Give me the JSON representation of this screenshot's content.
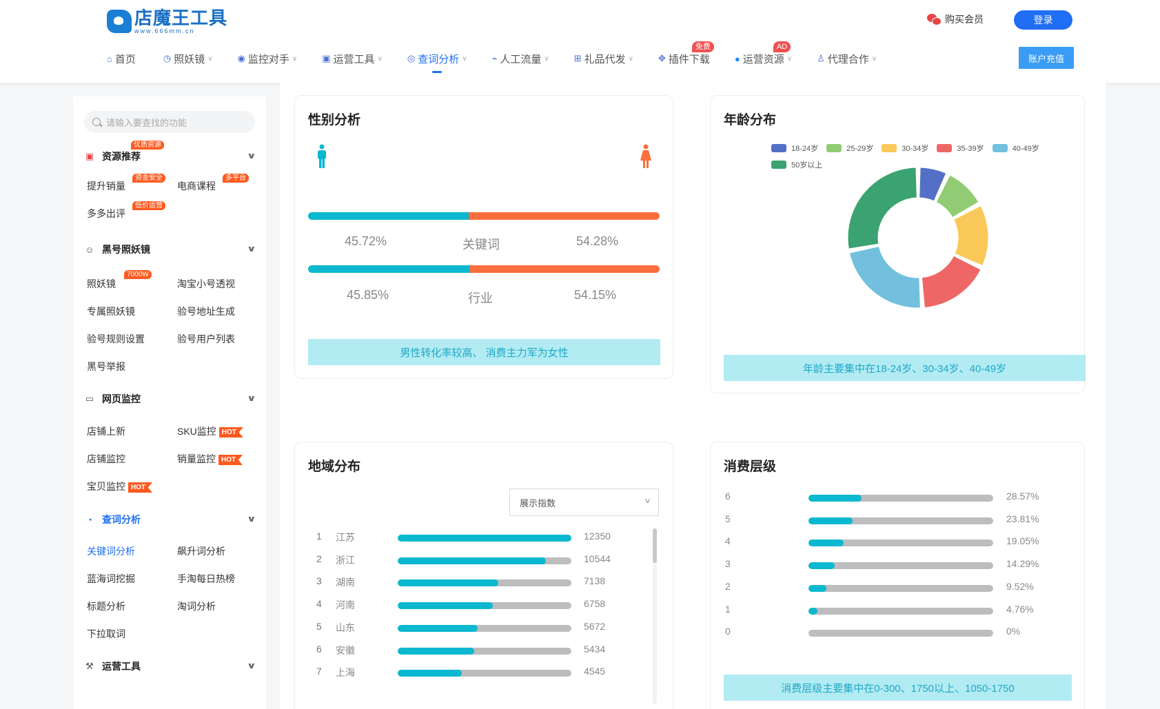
{
  "header": {
    "logo_title": "店魔王工具",
    "logo_url": "www.666mm.cn",
    "buy_vip": "购买会员",
    "login": "登录",
    "recharge": "账户充值",
    "nav": [
      {
        "label": "首页",
        "icon": "home-icon",
        "dropdown": false,
        "badge": ""
      },
      {
        "label": "照妖镜",
        "icon": "mirror-icon",
        "dropdown": true,
        "badge": ""
      },
      {
        "label": "监控对手",
        "icon": "location-icon",
        "dropdown": true,
        "badge": ""
      },
      {
        "label": "运营工具",
        "icon": "chart-icon",
        "dropdown": true,
        "badge": ""
      },
      {
        "label": "查词分析",
        "icon": "search-icon",
        "dropdown": true,
        "badge": "",
        "active": true
      },
      {
        "label": "人工流量",
        "icon": "pulse-icon",
        "dropdown": true,
        "badge": ""
      },
      {
        "label": "礼品代发",
        "icon": "gift-icon",
        "dropdown": true,
        "badge": ""
      },
      {
        "label": "插件下载",
        "icon": "puzzle-icon",
        "dropdown": false,
        "badge": "免费"
      },
      {
        "label": "运营资源",
        "icon": "drop-icon",
        "dropdown": true,
        "badge": "AD"
      },
      {
        "label": "代理合作",
        "icon": "user-icon",
        "dropdown": true,
        "badge": ""
      }
    ]
  },
  "sidebar": {
    "search_placeholder": "请输入要查找的功能",
    "sections": {
      "resources": {
        "title": "资源推荐",
        "tag": "优质资源",
        "items": [
          {
            "label": "提升销量",
            "tag": "资金安全"
          },
          {
            "label": "电商课程",
            "tag": "多平台"
          },
          {
            "label": "多多出评",
            "tag": "低价运营"
          }
        ]
      },
      "mirror": {
        "title": "黑号照妖镜",
        "items": [
          {
            "label": "照妖镜",
            "tag": "7000W"
          },
          {
            "label": "淘宝小号透视"
          },
          {
            "label": "专属照妖镜"
          },
          {
            "label": "验号地址生成"
          },
          {
            "label": "验号规则设置"
          },
          {
            "label": "验号用户列表"
          },
          {
            "label": "黑号举报"
          }
        ]
      },
      "monitor": {
        "title": "网页监控",
        "items": [
          {
            "label": "店铺上新"
          },
          {
            "label": "SKU监控",
            "hot": "HOT"
          },
          {
            "label": "店铺监控"
          },
          {
            "label": "销量监控",
            "hot": "HOT"
          },
          {
            "label": "宝贝监控",
            "hot": "HOT"
          }
        ]
      },
      "words": {
        "title": "查词分析",
        "items": [
          {
            "label": "关键词分析"
          },
          {
            "label": "飙升词分析"
          },
          {
            "label": "蓝海词挖掘"
          },
          {
            "label": "手淘每日热榜"
          },
          {
            "label": "标题分析"
          },
          {
            "label": "淘词分析"
          },
          {
            "label": "下拉取词"
          }
        ]
      },
      "ops": {
        "title": "运营工具"
      }
    }
  },
  "gender": {
    "title": "性别分析",
    "rows": [
      {
        "male": "45.72%",
        "label": "关键词",
        "female": "54.28%",
        "male_value": 45.72
      },
      {
        "male": "45.85%",
        "label": "行业",
        "female": "54.15%",
        "male_value": 45.85
      }
    ],
    "summary": "男性转化率较高、 消费主力军为女性",
    "colors": {
      "male": "#0ab8cf",
      "female": "#fb6e3d"
    }
  },
  "age": {
    "title": "年龄分布",
    "summary": "年龄主要集中在18-24岁、30-34岁、40-49岁"
  },
  "chart_data": {
    "type": "pie",
    "title": "年龄分布",
    "categories": [
      "18-24岁",
      "25-29岁",
      "30-34岁",
      "35-39岁",
      "40-49岁",
      "50岁以上"
    ],
    "values": [
      7,
      10,
      15,
      17,
      23,
      28
    ],
    "colors": [
      "#5470c6",
      "#91cc75",
      "#fac858",
      "#ee6666",
      "#73c0de",
      "#3ba272"
    ],
    "legend_position": "top"
  },
  "region": {
    "title": "地域分布",
    "dropdown": "展示指数",
    "rows": [
      {
        "rank": "1",
        "name": "江苏",
        "value": 12350
      },
      {
        "rank": "2",
        "name": "浙江",
        "value": 10544
      },
      {
        "rank": "3",
        "name": "湖南",
        "value": 7138
      },
      {
        "rank": "4",
        "name": "河南",
        "value": 6758
      },
      {
        "rank": "5",
        "name": "山东",
        "value": 5672
      },
      {
        "rank": "6",
        "name": "安徽",
        "value": 5434
      },
      {
        "rank": "7",
        "name": "上海",
        "value": 4545
      }
    ]
  },
  "consumption": {
    "title": "消费层级",
    "rows": [
      {
        "level": "6",
        "percent": "28.57%",
        "value": 28.57
      },
      {
        "level": "5",
        "percent": "23.81%",
        "value": 23.81
      },
      {
        "level": "4",
        "percent": "19.05%",
        "value": 19.05
      },
      {
        "level": "3",
        "percent": "14.29%",
        "value": 14.29
      },
      {
        "level": "2",
        "percent": "9.52%",
        "value": 9.52
      },
      {
        "level": "1",
        "percent": "4.76%",
        "value": 4.76
      },
      {
        "level": "0",
        "percent": "0%",
        "value": 0
      }
    ],
    "summary": "消费层级主要集中在0-300、1750以上、1050-1750"
  }
}
